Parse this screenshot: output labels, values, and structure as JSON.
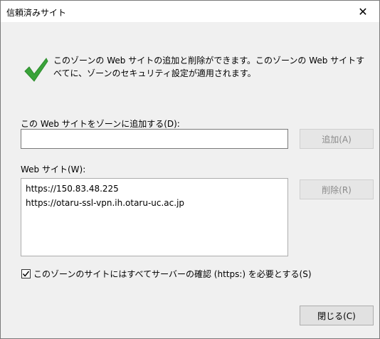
{
  "window": {
    "title": "信頼済みサイト",
    "close_label": "✕"
  },
  "info": {
    "icon": "checkmark-icon",
    "text": "このゾーンの Web サイトの追加と削除ができます。このゾーンの Web サイトすべてに、ゾーンのセキュリティ設定が適用されます。"
  },
  "add_site": {
    "label": "この Web サイトをゾーンに追加する(D):",
    "value": "",
    "placeholder": "",
    "add_button": "追加(A)"
  },
  "websites": {
    "label": "Web サイト(W):",
    "items": [
      "https://150.83.48.225",
      "https://otaru-ssl-vpn.ih.otaru-uc.ac.jp"
    ],
    "remove_button": "削除(R)"
  },
  "require_https": {
    "checked": true,
    "label": "このゾーンのサイトにはすべてサーバーの確認 (https:) を必要とする(S)"
  },
  "footer": {
    "close_button": "閉じる(C)"
  },
  "colors": {
    "check_green": "#3aa33a",
    "window_bg": "#f0f0f0"
  }
}
